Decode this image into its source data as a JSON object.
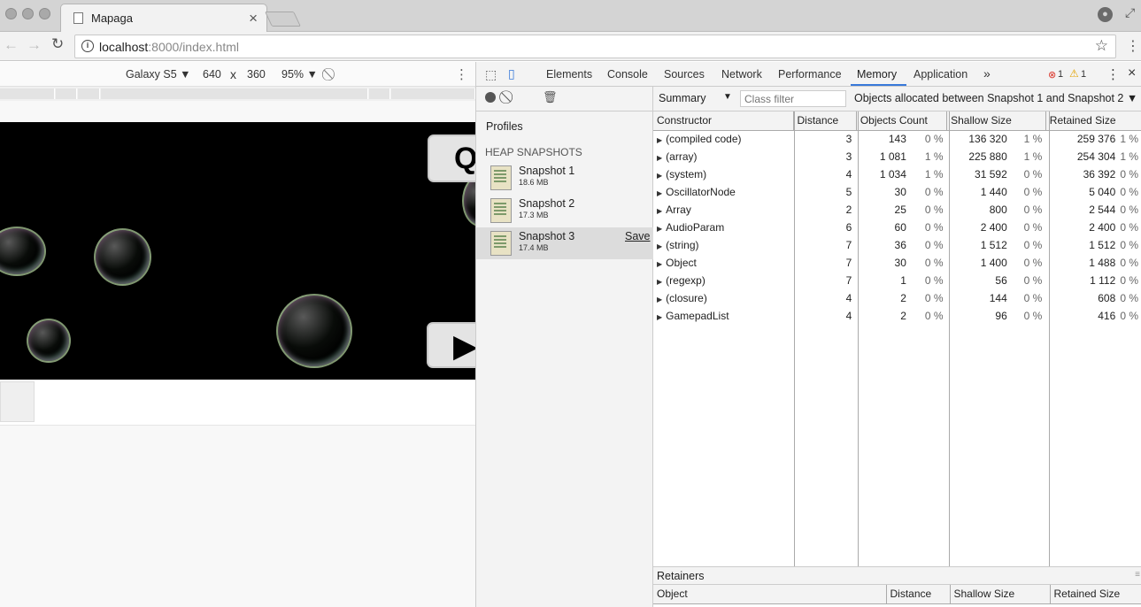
{
  "browser": {
    "tab_title": "Mapaga",
    "url_host": "localhost",
    "url_rest": ":8000/index.html"
  },
  "device_toolbar": {
    "device": "Galaxy S5 ▼",
    "width": "640",
    "times": "x",
    "height": "360",
    "zoom": "95% ▼"
  },
  "devtools": {
    "tabs": [
      "Elements",
      "Console",
      "Sources",
      "Network",
      "Performance",
      "Memory",
      "Application"
    ],
    "more_tabs": "»",
    "active_tab": "Memory",
    "error_count": "1",
    "warning_count": "1",
    "close_glyph": "×",
    "profiles": {
      "title": "Profiles",
      "section": "HEAP SNAPSHOTS",
      "snapshots": [
        {
          "name": "Snapshot 1",
          "size": "18.6 MB"
        },
        {
          "name": "Snapshot 2",
          "size": "17.3 MB"
        },
        {
          "name": "Snapshot 3",
          "size": "17.4 MB",
          "action": "Save"
        }
      ]
    },
    "summary": {
      "view": "Summary",
      "filter_placeholder": "Class filter",
      "range": "Objects allocated between Snapshot 1 and Snapshot 2 ▼"
    },
    "columns": [
      "Constructor",
      "Distance",
      "Objects Count",
      "Shallow Size",
      "Retained Size"
    ],
    "rows": [
      {
        "name": "(compiled code)",
        "distance": "3",
        "count": "143",
        "count_pct": "0 %",
        "shallow": "136 320",
        "shallow_pct": "1 %",
        "retained": "259 376",
        "retained_pct": "1 %"
      },
      {
        "name": "(array)",
        "distance": "3",
        "count": "1 081",
        "count_pct": "1 %",
        "shallow": "225 880",
        "shallow_pct": "1 %",
        "retained": "254 304",
        "retained_pct": "1 %"
      },
      {
        "name": "(system)",
        "distance": "4",
        "count": "1 034",
        "count_pct": "1 %",
        "shallow": "31 592",
        "shallow_pct": "0 %",
        "retained": "36 392",
        "retained_pct": "0 %"
      },
      {
        "name": "OscillatorNode",
        "distance": "5",
        "count": "30",
        "count_pct": "0 %",
        "shallow": "1 440",
        "shallow_pct": "0 %",
        "retained": "5 040",
        "retained_pct": "0 %"
      },
      {
        "name": "Array",
        "distance": "2",
        "count": "25",
        "count_pct": "0 %",
        "shallow": "800",
        "shallow_pct": "0 %",
        "retained": "2 544",
        "retained_pct": "0 %"
      },
      {
        "name": "AudioParam",
        "distance": "6",
        "count": "60",
        "count_pct": "0 %",
        "shallow": "2 400",
        "shallow_pct": "0 %",
        "retained": "2 400",
        "retained_pct": "0 %"
      },
      {
        "name": "(string)",
        "distance": "7",
        "count": "36",
        "count_pct": "0 %",
        "shallow": "1 512",
        "shallow_pct": "0 %",
        "retained": "1 512",
        "retained_pct": "0 %"
      },
      {
        "name": "Object",
        "distance": "7",
        "count": "30",
        "count_pct": "0 %",
        "shallow": "1 400",
        "shallow_pct": "0 %",
        "retained": "1 488",
        "retained_pct": "0 %"
      },
      {
        "name": "(regexp)",
        "distance": "7",
        "count": "1",
        "count_pct": "0 %",
        "shallow": "56",
        "shallow_pct": "0 %",
        "retained": "1 112",
        "retained_pct": "0 %"
      },
      {
        "name": "(closure)",
        "distance": "4",
        "count": "2",
        "count_pct": "0 %",
        "shallow": "144",
        "shallow_pct": "0 %",
        "retained": "608",
        "retained_pct": "0 %"
      },
      {
        "name": "GamepadList",
        "distance": "4",
        "count": "2",
        "count_pct": "0 %",
        "shallow": "96",
        "shallow_pct": "0 %",
        "retained": "416",
        "retained_pct": "0 %"
      }
    ],
    "retainers": {
      "title": "Retainers",
      "columns": [
        "Object",
        "Distance",
        "Shallow Size",
        "Retained Size"
      ]
    }
  }
}
